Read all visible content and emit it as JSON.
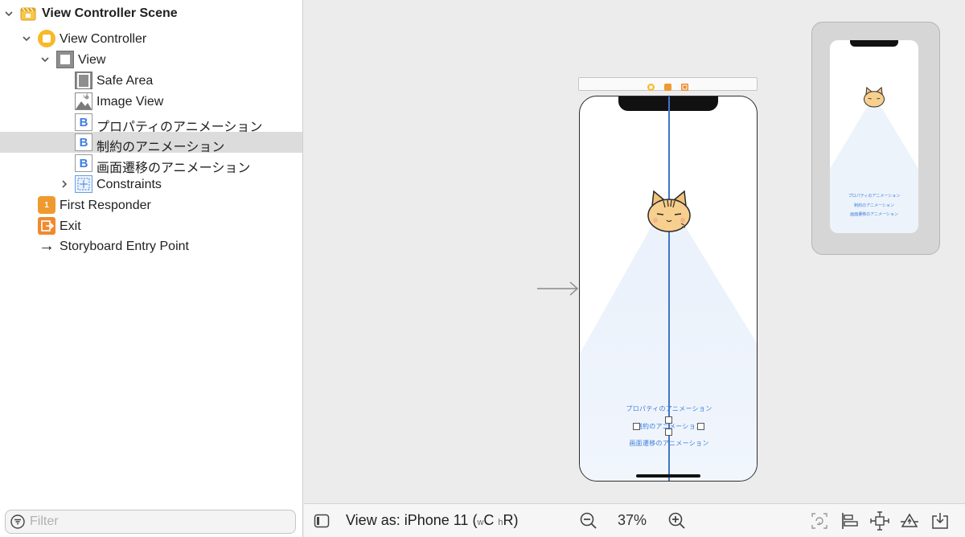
{
  "outline": {
    "items": [
      {
        "label": "View Controller Scene",
        "icon": "scene-icon"
      },
      {
        "label": "View Controller",
        "icon": "view-controller-icon"
      },
      {
        "label": "View",
        "icon": "view-icon"
      },
      {
        "label": "Safe Area",
        "icon": "safe-area-icon"
      },
      {
        "label": "Image View",
        "icon": "image-view-icon"
      },
      {
        "label": "プロパティのアニメーション",
        "icon": "button-icon",
        "glyph": "B"
      },
      {
        "label": "制約のアニメーション",
        "icon": "button-icon",
        "glyph": "B"
      },
      {
        "label": "画面遷移のアニメーション",
        "icon": "button-icon",
        "glyph": "B"
      },
      {
        "label": "Constraints",
        "icon": "constraints-icon"
      },
      {
        "label": "First Responder",
        "icon": "first-responder-icon",
        "glyph": "1"
      },
      {
        "label": "Exit",
        "icon": "exit-icon"
      },
      {
        "label": "Storyboard Entry Point",
        "icon": "arrow-right-icon",
        "glyph": "→"
      }
    ],
    "selected_index": 6
  },
  "filter": {
    "placeholder": "Filter"
  },
  "canvas": {
    "phone_buttons": [
      "プロパティのアニメーション",
      "制約のアニメーション",
      "画面遷移のアニメーション"
    ],
    "preview_buttons": [
      "プロパティのアニメーション",
      "制約のアニメーション",
      "画面遷移のアニメーション"
    ]
  },
  "bottombar": {
    "view_as_prefix": "View as: iPhone 11 (",
    "w": "w",
    "c": "C",
    "h": "h",
    "r": "R)",
    "zoom": "37%"
  },
  "colors": {
    "accent": "#3b7fd8",
    "vc_yellow": "#f8b928",
    "first_responder_orange": "#ef9a2e"
  }
}
